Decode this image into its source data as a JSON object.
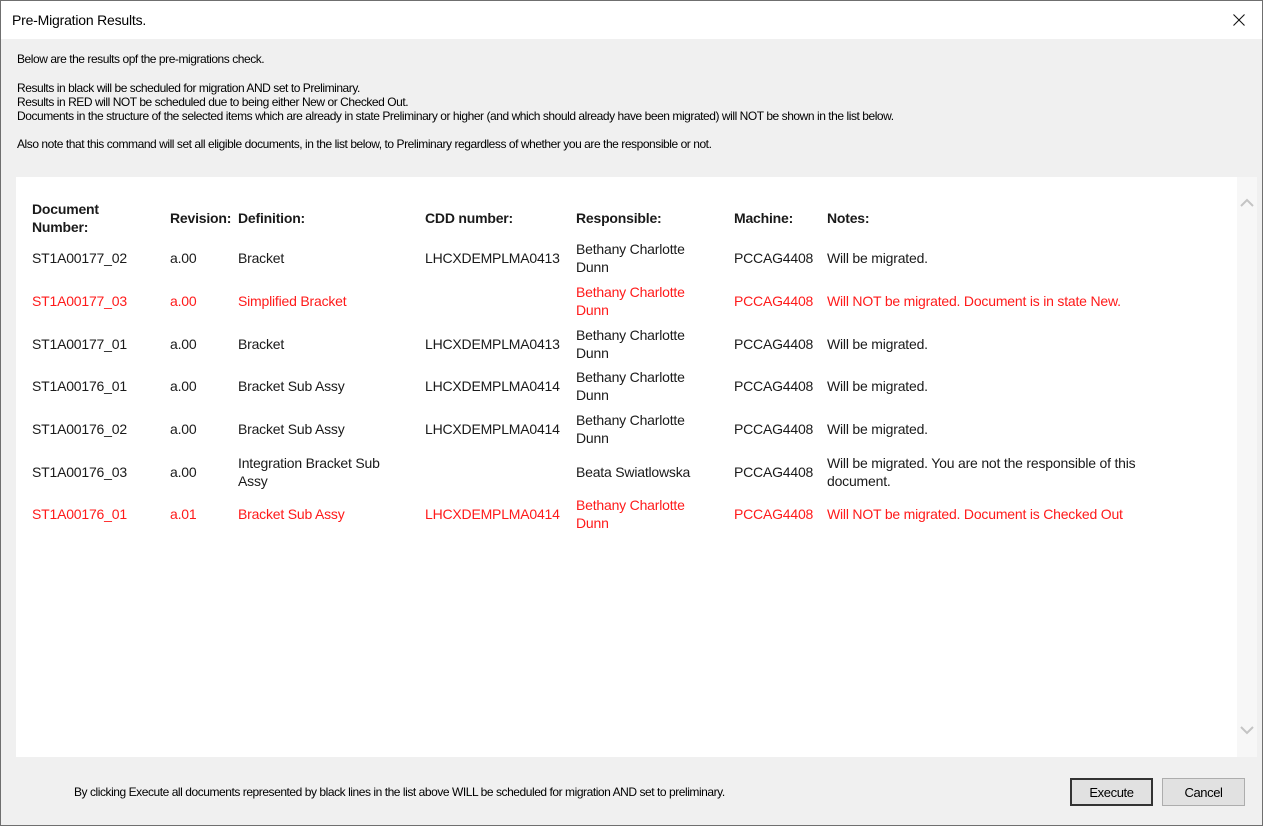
{
  "window": {
    "title": "Pre-Migration Results.",
    "close_icon": "close-icon"
  },
  "intro": {
    "line1": "Below are the results opf the pre-migrations check.",
    "line2": "Results in black will be scheduled for migration AND set to Preliminary.",
    "line3": "Results in RED will NOT be scheduled due to being either New or Checked Out.",
    "line4": "Documents in the structure of the selected items which are already in state Preliminary or higher (and which should already have been migrated) will NOT be shown in the list below.",
    "line5": "Also note that this command will set all eligible documents, in the list below, to Preliminary regardless of whether you are the responsible or not."
  },
  "colors": {
    "ok_text": "#1a1a1a",
    "excluded_text": "#ff1a1a"
  },
  "table": {
    "headers": [
      "Document Number:",
      "Revision:",
      "Definition:",
      "CDD number:",
      "Responsible:",
      "Machine:",
      "Notes:"
    ],
    "rows": [
      {
        "status": "ok",
        "cells": [
          "ST1A00177_02",
          "a.00",
          "Bracket",
          "LHCXDEMPLMA0413",
          "Bethany Charlotte Dunn",
          "PCCAG4408",
          "Will be migrated."
        ]
      },
      {
        "status": "bad",
        "cells": [
          "ST1A00177_03",
          "a.00",
          "Simplified Bracket",
          "",
          "Bethany Charlotte Dunn",
          "PCCAG4408",
          "Will NOT be migrated. Document is in state New."
        ]
      },
      {
        "status": "ok",
        "cells": [
          "ST1A00177_01",
          "a.00",
          "Bracket",
          "LHCXDEMPLMA0413",
          "Bethany Charlotte Dunn",
          "PCCAG4408",
          "Will be migrated."
        ]
      },
      {
        "status": "ok",
        "cells": [
          "ST1A00176_01",
          "a.00",
          "Bracket Sub Assy",
          "LHCXDEMPLMA0414",
          "Bethany Charlotte Dunn",
          "PCCAG4408",
          "Will be migrated."
        ]
      },
      {
        "status": "ok",
        "cells": [
          "ST1A00176_02",
          "a.00",
          "Bracket Sub Assy",
          "LHCXDEMPLMA0414",
          "Bethany Charlotte Dunn",
          "PCCAG4408",
          "Will be migrated."
        ]
      },
      {
        "status": "ok",
        "cells": [
          "ST1A00176_03",
          "a.00",
          "Integration Bracket Sub Assy",
          "",
          "Beata Swiatlowska",
          "PCCAG4408",
          "Will be migrated. You are not the responsible of this document."
        ]
      },
      {
        "status": "bad",
        "cells": [
          "ST1A00176_01",
          "a.01",
          "Bracket Sub Assy",
          "LHCXDEMPLMA0414",
          "Bethany Charlotte Dunn",
          "PCCAG4408",
          "Will NOT be migrated. Document is Checked Out"
        ]
      }
    ]
  },
  "scrollbar": {
    "up_icon": "chevron-up-icon",
    "down_icon": "chevron-down-icon"
  },
  "footer": {
    "text": "By clicking Execute all documents represented by black lines in the list above WILL be scheduled for migration AND set to preliminary.",
    "execute_label": "Execute",
    "cancel_label": "Cancel"
  }
}
